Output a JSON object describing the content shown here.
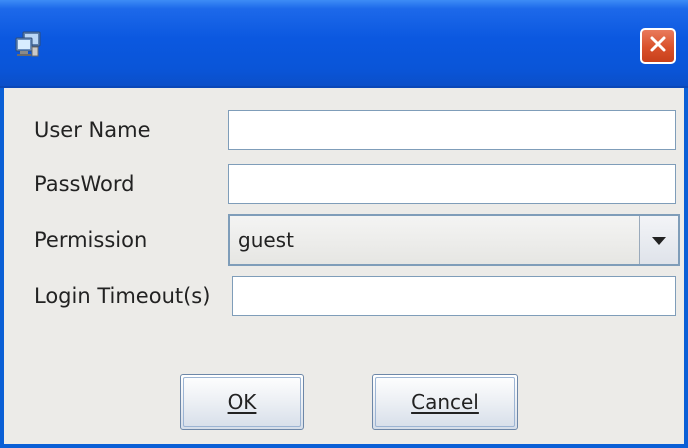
{
  "titlebar": {
    "icon": "computer-icon",
    "close_icon": "close-icon"
  },
  "form": {
    "username_label": "User Name",
    "username_value": "",
    "password_label": "PassWord",
    "password_value": "",
    "permission_label": "Permission",
    "permission_value": "guest",
    "timeout_label": "Login Timeout(s)",
    "timeout_value": ""
  },
  "buttons": {
    "ok_label": "OK",
    "cancel_label": "Cancel"
  },
  "colors": {
    "titlebar": "#0a55d8",
    "close": "#d9512b",
    "dialog_bg": "#ecebe8",
    "field_border": "#7f9db9"
  }
}
